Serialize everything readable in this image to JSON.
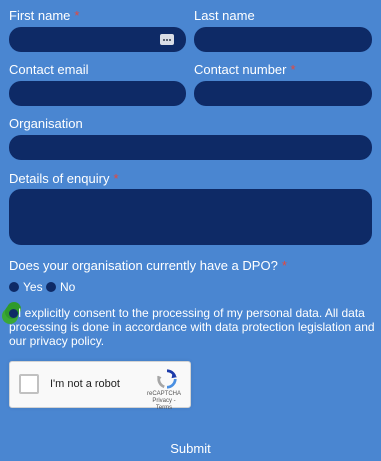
{
  "form": {
    "first_name": {
      "label": "First name",
      "required": "*",
      "value": ""
    },
    "last_name": {
      "label": "Last name",
      "value": ""
    },
    "contact_email": {
      "label": "Contact email",
      "value": ""
    },
    "contact_number": {
      "label": "Contact number",
      "required": "*",
      "value": ""
    },
    "organisation": {
      "label": "Organisation",
      "value": ""
    },
    "details": {
      "label": "Details of enquiry",
      "required": "*",
      "value": ""
    },
    "dpo_question": {
      "label": "Does your organisation currently have a DPO?",
      "required": "*",
      "options": [
        "Yes",
        "No"
      ]
    },
    "consent_text": "I explicitly consent to the processing of my personal data. All data processing is done in accordance with data protection legislation and our privacy policy.",
    "recaptcha": {
      "label": "I'm not a robot",
      "brand": "reCAPTCHA",
      "links": "Privacy - Terms"
    },
    "submit_label": "Submit"
  },
  "colors": {
    "background": "#4a86d1",
    "field": "#0e2a66",
    "required": "#e8473a",
    "consent_marker": "#2f9a2b"
  },
  "icons": [
    "autofill-key-icon",
    "recaptcha-logo-icon"
  ]
}
